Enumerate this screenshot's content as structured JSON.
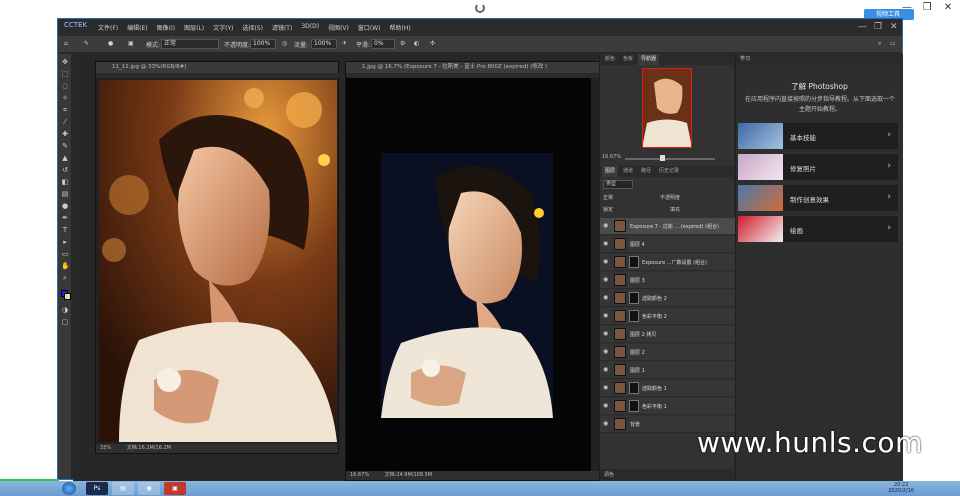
{
  "browser": {
    "action_button": "视频工具",
    "minimize": "—",
    "restore": "❐",
    "close": "✕"
  },
  "app": {
    "title_logo": "CCTEK",
    "menu": [
      "文件(F)",
      "编辑(E)",
      "图像(I)",
      "图层(L)",
      "文字(Y)",
      "选择(S)",
      "滤镜(T)",
      "3D(D)",
      "视图(V)",
      "窗口(W)",
      "帮助(H)"
    ]
  },
  "options_bar": {
    "mode_label": "模式:",
    "mode_value": "正常",
    "opacity_label": "不透明度:",
    "opacity_value": "100%",
    "flow_label": "流量:",
    "flow_value": "100%",
    "smooth_label": "平滑:",
    "smooth_value": "0%"
  },
  "documents": [
    {
      "tab": "11_11.jpg @ 33%(RGB/8#)",
      "zoom": "33%",
      "doc_size": "文档:16.2M/16.2M"
    },
    {
      "tab": "1.jpg @ 16.7% (Exposure 7 - 拉斯美 - 富士 Pro 800Z (expired) (修改 )",
      "zoom": "16.67%",
      "doc_size": "文档:24.9M/108.5M"
    }
  ],
  "navigator": {
    "tabs": [
      "颜色",
      "色板",
      "导航器"
    ],
    "zoom": "16.67%"
  },
  "layers_panel": {
    "tabs": [
      "图层",
      "通道",
      "路径",
      "历史记录"
    ],
    "filter_label": "类型",
    "mode_label": "正常",
    "opacity_label": "不透明度",
    "lock_label": "锁定",
    "fill_label": "填充",
    "layers": [
      {
        "name": "Exposure 7 - 拉斯 ... (expired) (组合)",
        "selected": true,
        "mask": false
      },
      {
        "name": "图层 4",
        "selected": false,
        "mask": false
      },
      {
        "name": "Exposure ...厂数设置 (组合)",
        "selected": false,
        "mask": true
      },
      {
        "name": "图层 3",
        "selected": false,
        "mask": false
      },
      {
        "name": "选取颜色 2",
        "selected": false,
        "mask": true
      },
      {
        "name": "色彩平衡 2",
        "selected": false,
        "mask": true
      },
      {
        "name": "图层 2 拷贝",
        "selected": false,
        "mask": false
      },
      {
        "name": "图层 2",
        "selected": false,
        "mask": false
      },
      {
        "name": "图层 1",
        "selected": false,
        "mask": false
      },
      {
        "name": "选取颜色 1",
        "selected": false,
        "mask": true
      },
      {
        "name": "色彩平衡 1",
        "selected": false,
        "mask": true
      },
      {
        "name": "背景",
        "selected": false,
        "mask": false
      }
    ],
    "bottom_tab": "调色"
  },
  "learn_panel": {
    "tab": "学习",
    "title": "了解 Photoshop",
    "description": "在应用程序内直接按照的分步指导教程。从下面选取一个主题开始教程。",
    "items": [
      "基本技能",
      "修复照片",
      "制作创意效果",
      "绘画"
    ]
  },
  "taskbar": {
    "clock_time": "20:22",
    "clock_date": "2020/2/16"
  },
  "watermark": "www.hunls.com",
  "colors": {
    "ps_bg": "#2b2b2b",
    "accent_blue": "#1f6fb8",
    "taskbar": "#6a9bd0"
  }
}
